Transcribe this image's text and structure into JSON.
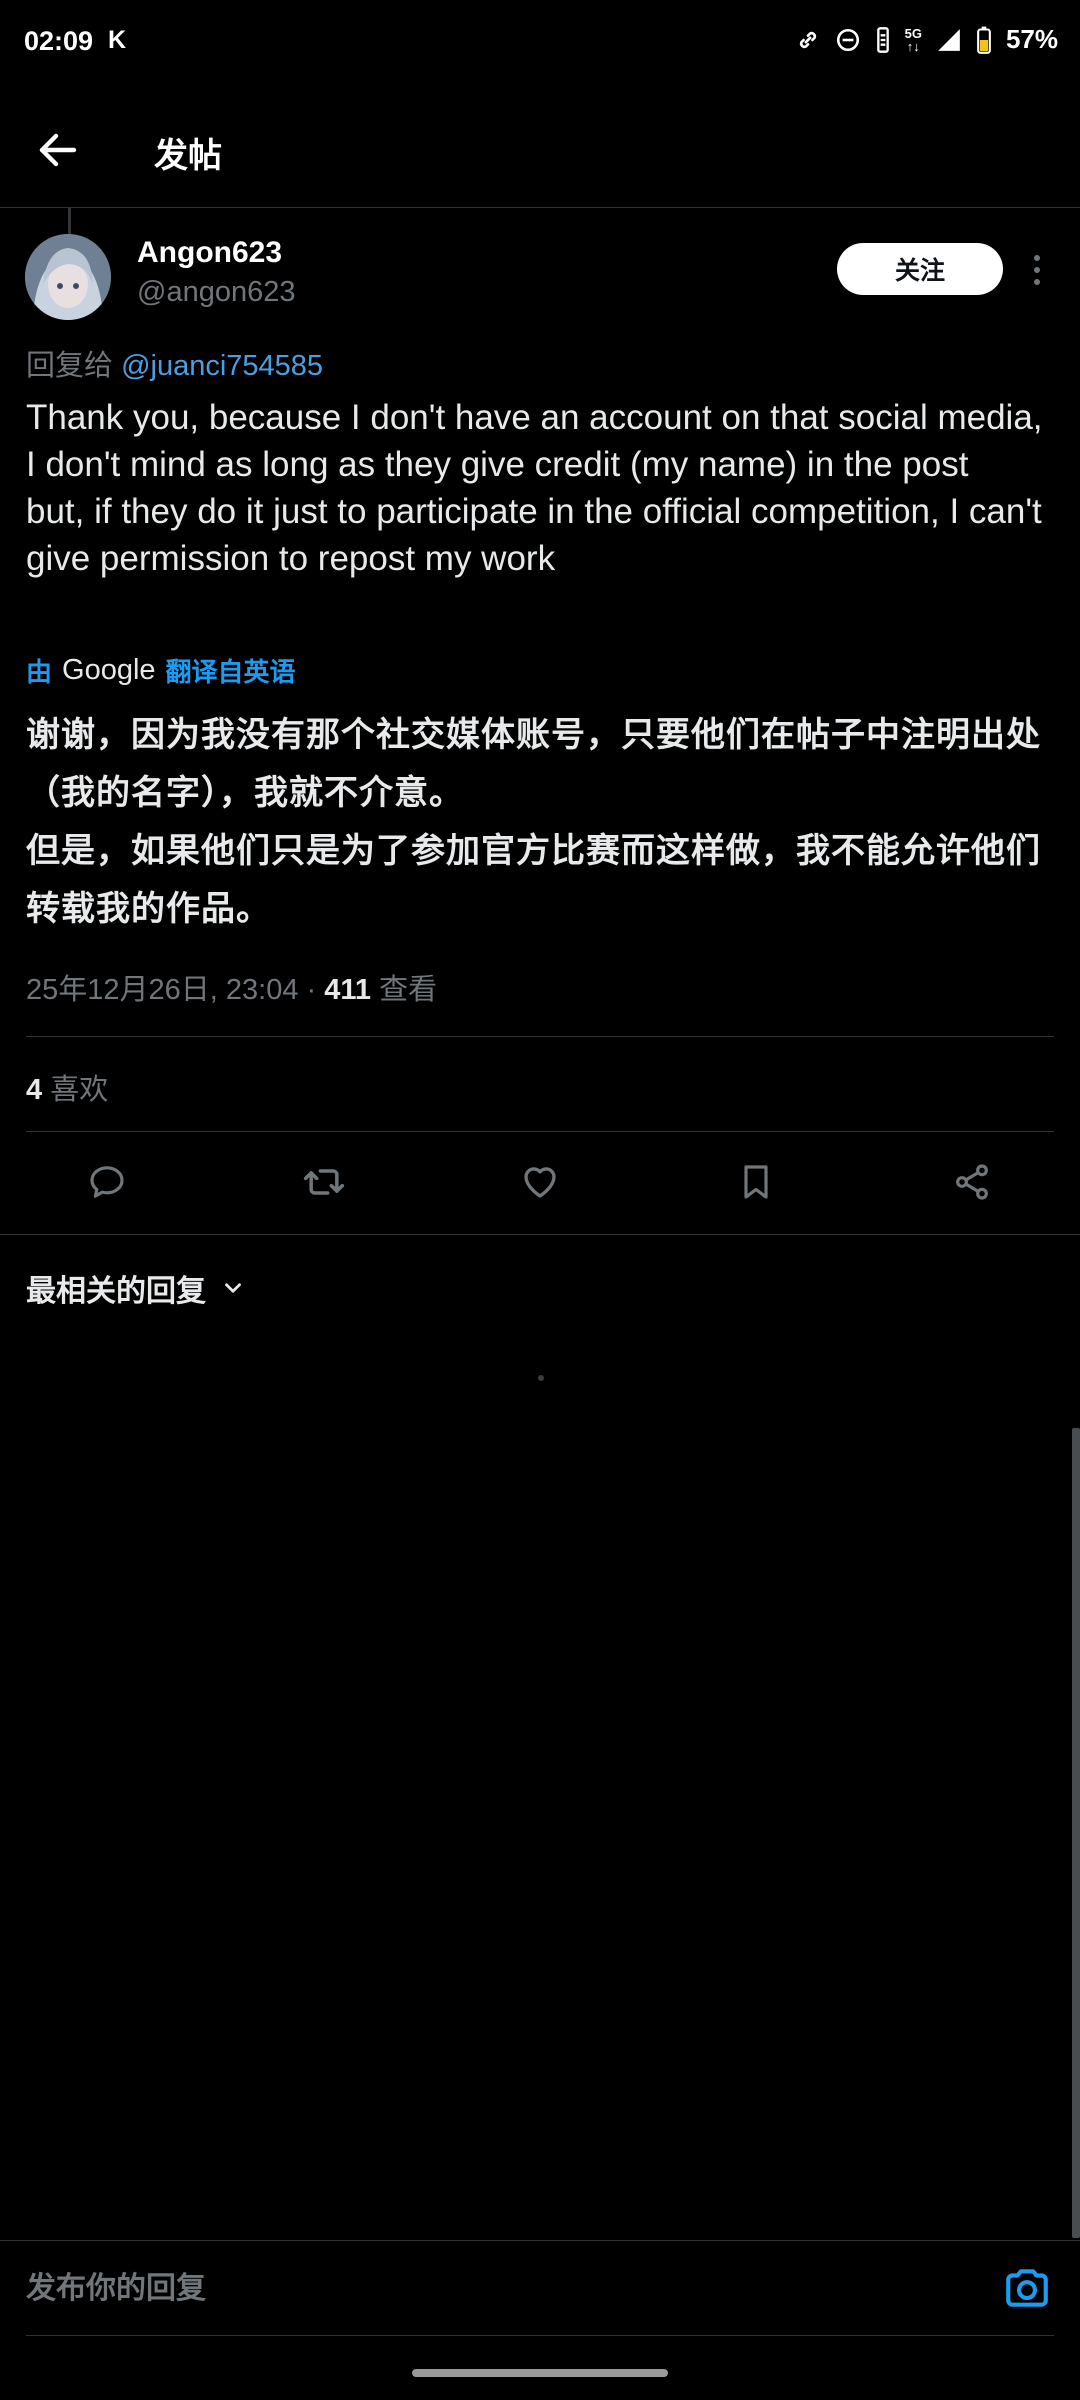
{
  "status_bar": {
    "time": "02:09",
    "carrier_glyph": "K",
    "network": "5G",
    "battery": "57%",
    "icons": [
      "link-icon",
      "dnd-icon",
      "vibrate-icon",
      "signal-icon",
      "battery-icon"
    ]
  },
  "header": {
    "title": "发帖",
    "back_icon": "arrow-left-icon"
  },
  "tweet": {
    "author_name": "Angon623",
    "author_handle": "@angon623",
    "follow_label": "关注",
    "reply_prefix": "回复给",
    "reply_mention": "@juanci754585",
    "text_en_1": "Thank you, because I don't have an account on that social media, I don't mind as long as they give credit (my name) in the post",
    "text_en_2": "but, if they do it just to participate in the official competition, I can't give permission to repost my work",
    "translate_by": "由",
    "translate_google": "Google",
    "translate_link": "翻译自英语",
    "text_zh_1": "谢谢，因为我没有那个社交媒体账号，只要他们在帖子中注明出处（我的名字），我就不介意。",
    "text_zh_2": "但是，如果他们只是为了参加官方比赛而这样做，我不能允许他们转载我的作品。",
    "timestamp": "25年12月26日, 23:04",
    "separator": " · ",
    "views_count": "411",
    "views_label": " 查看",
    "likes_count": "4",
    "likes_label": " 喜欢"
  },
  "actions": [
    {
      "name": "reply-icon"
    },
    {
      "name": "retweet-icon"
    },
    {
      "name": "like-icon"
    },
    {
      "name": "bookmark-icon"
    },
    {
      "name": "share-icon"
    }
  ],
  "replies": {
    "sort_label": "最相关的回复"
  },
  "compose": {
    "placeholder": "发布你的回复"
  },
  "colors": {
    "background": "#000000",
    "accent": "#1d9bf0",
    "muted": "#71767b",
    "divider": "#2f3336"
  }
}
